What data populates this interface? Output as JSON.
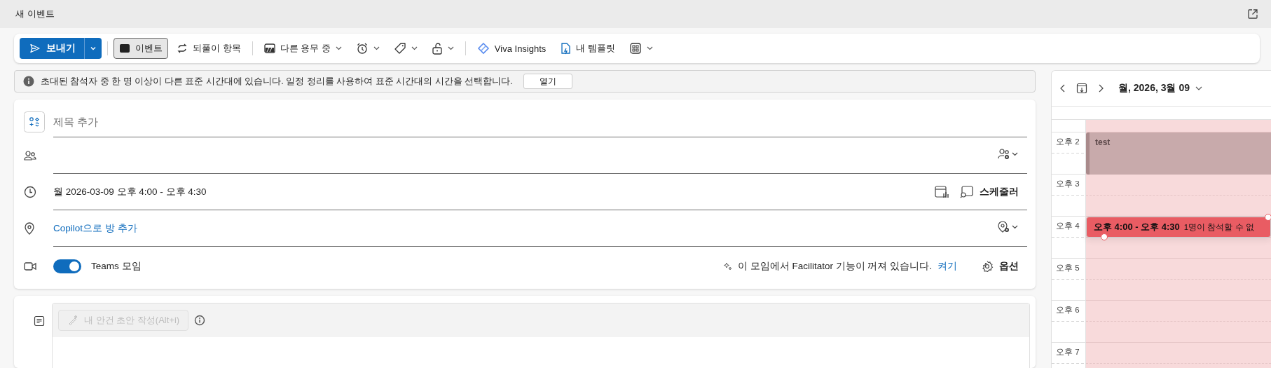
{
  "window": {
    "title": "새 이벤트"
  },
  "toolbar": {
    "send": "보내기",
    "event_toggle": {
      "label": "이벤트",
      "selected": true
    },
    "recurrence": "되풀이 항목",
    "show_as": "다른 용무 중",
    "viva": "Viva Insights",
    "templates": "내 템플릿"
  },
  "info_bar": {
    "message": "초대된 참석자 중 한 명 이상이 다른 표준 시간대에 있습니다. 일정 정리를 사용하여 표준 시간대의 시간을 선택합니다.",
    "button": "열기"
  },
  "form": {
    "title_placeholder": "제목 추가",
    "time": "월 2026-03-09 오후 4:00 - 오후 4:30",
    "scheduler": "스케줄러",
    "location_link": "Copilot으로 방 추가",
    "teams": {
      "label": "Teams 모임",
      "on": true
    },
    "facilitator_message": "이 모임에서 Facilitator 기능이 꺼져 있습니다.",
    "turn_on": "켜기",
    "options": "옵션"
  },
  "body": {
    "draft_button": {
      "label": "내 안건 초안 작성(Alt+i)",
      "disabled": true
    }
  },
  "calendar": {
    "date": "월, 2026, 3월 09",
    "hours": [
      {
        "label": "오후 2",
        "events": [
          {
            "kind": "busy",
            "title": "test"
          }
        ]
      },
      {
        "label": "오후 3"
      },
      {
        "label": "오후 4",
        "events": [
          {
            "kind": "draft",
            "time": "오후 4:00 - 오후 4:30",
            "note": "1명이 참석할 수 없"
          }
        ]
      },
      {
        "label": "오후 5"
      },
      {
        "label": "오후 6"
      },
      {
        "label": "오후 7"
      }
    ]
  }
}
